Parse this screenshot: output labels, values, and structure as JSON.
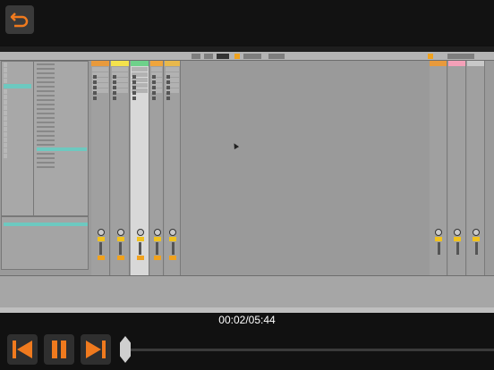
{
  "player": {
    "time_display": "00:02/05:44",
    "progress": 0.006,
    "accent_color": "#f07a1e"
  },
  "icons": {
    "back": "back-arrow-icon",
    "skip_back": "skip-back-icon",
    "pause": "pause-icon",
    "skip_forward": "skip-forward-icon"
  },
  "session": {
    "tracks": [
      {
        "color": "#e89a3c",
        "selected": false
      },
      {
        "color": "#f4e24c",
        "selected": false
      },
      {
        "color": "#6ed18a",
        "selected": true
      },
      {
        "color": "#f0a53c",
        "selected": false
      },
      {
        "color": "#e8b84c",
        "selected": false
      }
    ],
    "returns": [
      {
        "color": "#e89a3c"
      },
      {
        "color": "#f4a0b8"
      },
      {
        "color": "#c8c8c8"
      }
    ]
  }
}
